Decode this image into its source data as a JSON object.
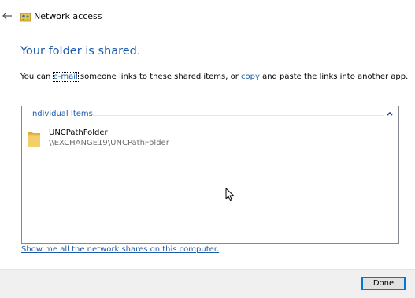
{
  "window": {
    "title": "Network access"
  },
  "main": {
    "heading": "Your folder is shared.",
    "description": {
      "prefix": "You can ",
      "email_link": "e-mail",
      "middle": " someone links to these shared items, or ",
      "copy_link": "copy",
      "suffix": " and paste the links into another app."
    }
  },
  "list": {
    "group_label": "Individual Items",
    "items": [
      {
        "name": "UNCPathFolder",
        "path": "\\\\EXCHANGE19\\UNCPathFolder",
        "icon": "folder-icon"
      }
    ]
  },
  "network_link": "Show me all the network shares on this computer.",
  "footer": {
    "done_label": "Done"
  },
  "icons": {
    "back": "back-arrow-icon",
    "app": "network-sharing-icon",
    "collapse": "chevron-up-icon",
    "cursor": "mouse-pointer-icon"
  },
  "colors": {
    "accent": "#1e5aa8",
    "button_border": "#0078d7",
    "footer_bg": "#f0f0f0"
  }
}
